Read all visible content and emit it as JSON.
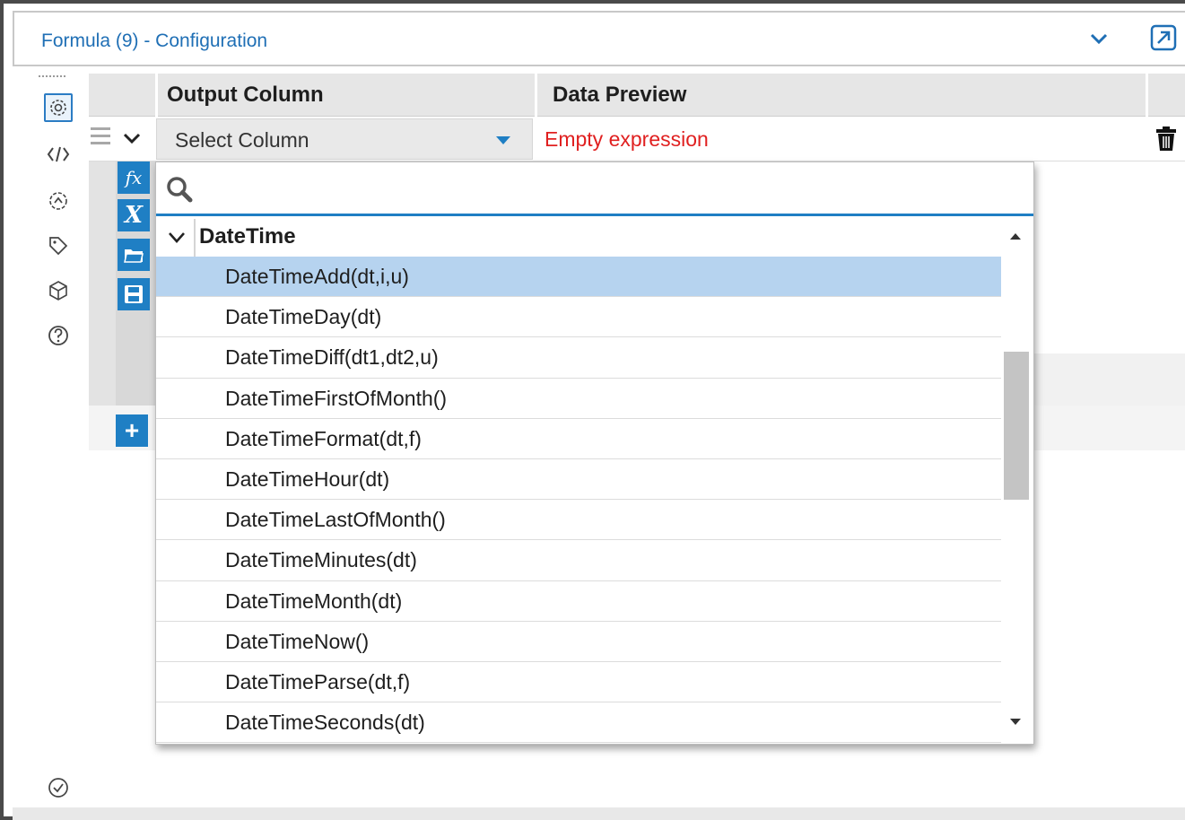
{
  "window": {
    "title": "Formula (9) - Configuration"
  },
  "header_actions": {
    "collapse_icon": "chevron-down-icon",
    "popout_icon": "popout-icon"
  },
  "rail": {
    "items": [
      {
        "icon": "gear-icon",
        "selected": true
      },
      {
        "icon": "code-icon",
        "selected": false
      },
      {
        "icon": "annotation-icon",
        "selected": false
      },
      {
        "icon": "tag-icon",
        "selected": false
      },
      {
        "icon": "cube-icon",
        "selected": false
      },
      {
        "icon": "help-icon",
        "selected": false
      }
    ],
    "bottom_icon": "check-circle-icon"
  },
  "table": {
    "columns": [
      "Output Column",
      "Data Preview"
    ],
    "row": {
      "output_column": "Select Column",
      "data_preview": "Empty expression"
    }
  },
  "editor_tools": [
    "fx",
    "X",
    "open-folder-icon",
    "save-icon"
  ],
  "function_picker": {
    "search_value": "",
    "group": "DateTime",
    "selected_index": 0,
    "items": [
      "DateTimeAdd(dt,i,u)",
      "DateTimeDay(dt)",
      "DateTimeDiff(dt1,dt2,u)",
      "DateTimeFirstOfMonth()",
      "DateTimeFormat(dt,f)",
      "DateTimeHour(dt)",
      "DateTimeLastOfMonth()",
      "DateTimeMinutes(dt)",
      "DateTimeMonth(dt)",
      "DateTimeNow()",
      "DateTimeParse(dt,f)",
      "DateTimeSeconds(dt)"
    ]
  },
  "colors": {
    "accent": "#1f7fc4",
    "title": "#1f6fb5",
    "error": "#e02020",
    "selection": "#b6d3ef"
  }
}
